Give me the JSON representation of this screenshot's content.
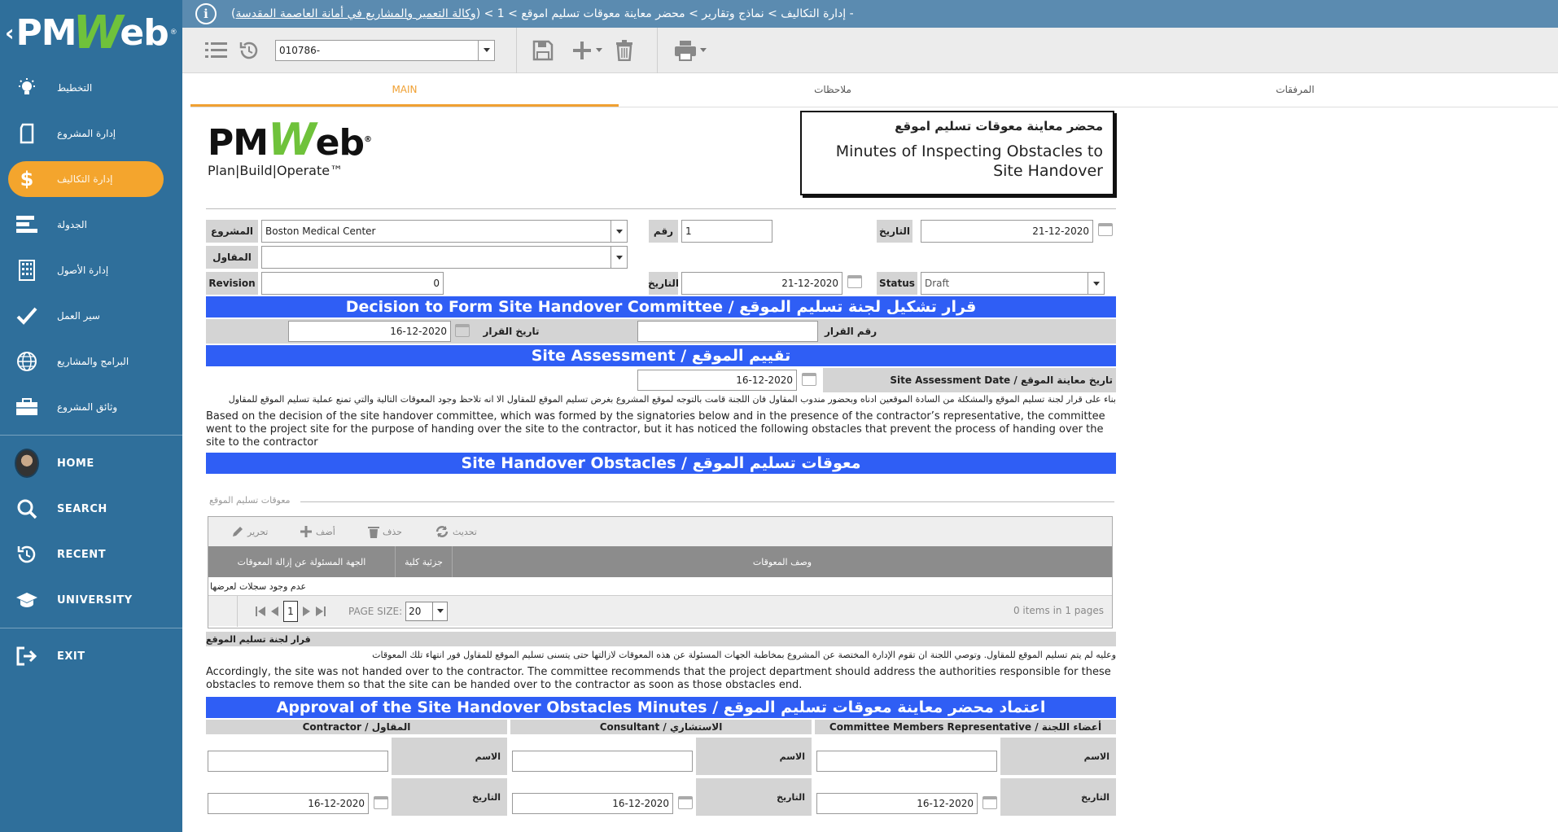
{
  "sidebar": {
    "logo_text": "PMWeb",
    "items": [
      {
        "label": "التخطيط",
        "icon": "lightbulb-icon"
      },
      {
        "label": "إدارة المشروع",
        "icon": "document-icon"
      },
      {
        "label": "إدارة التكاليف",
        "icon": "dollar-icon",
        "active": true
      },
      {
        "label": "الجدولة",
        "icon": "schedule-bars-icon"
      },
      {
        "label": "إدارة الأصول",
        "icon": "building-icon"
      },
      {
        "label": "سير العمل",
        "icon": "checkmark-icon"
      },
      {
        "label": "البرامج والمشاريع",
        "icon": "globe-icon"
      },
      {
        "label": "وثائق المشروع",
        "icon": "briefcase-icon"
      }
    ],
    "lower": [
      {
        "label": "HOME",
        "icon": "avatar"
      },
      {
        "label": "SEARCH",
        "icon": "search-icon"
      },
      {
        "label": "RECENT",
        "icon": "history-icon"
      },
      {
        "label": "UNIVERSITY",
        "icon": "graduation-cap-icon"
      },
      {
        "label": "EXIT",
        "icon": "exit-icon"
      }
    ]
  },
  "topbar": {
    "breadcrumb_prefix": "- إدارة التكاليف > نماذج وتقارير > محضر معاينة معوقات تسليم اموقع > 1 > (",
    "breadcrumb_link": "وكالة التعمير والمشاريع في أمانة العاصمة المقدسة",
    "breadcrumb_suffix": ")"
  },
  "toolbar": {
    "record_select": "010786-"
  },
  "tabs": [
    "MAIN",
    "ملاحظات",
    "المرفقات"
  ],
  "form": {
    "logo_tagline": "Plan|Build|Operate™",
    "title_ar": "محضر معاينة معوقات تسليم اموقع",
    "title_en": "Minutes of Inspecting Obstacles to Site Handover",
    "project_label": "المشروع",
    "project_value": "Boston Medical Center",
    "contractor_label": "المقاول",
    "contractor_value": "",
    "revision_label": "Revision",
    "revision_value": "0",
    "number_label": "رقم",
    "number_value": "1",
    "date_label": "التاريخ",
    "date_value": "21-12-2020",
    "date2_label": "التاريخ",
    "date2_value": "21-12-2020",
    "status_label": "Status",
    "status_value": "Draft",
    "section1": "قرار تشكيل لجنة تسليم الموقع / Decision to Form Site Handover Committee",
    "decision_date_label": "تاريخ القرار",
    "decision_date_value": "16-12-2020",
    "decision_number_label": "رقم  القرار",
    "decision_number_value": "",
    "section2": "تقييم الموقع / Site Assessment",
    "assessment_date_label": "Site Assessment Date / تاريخ معاينة الموقع",
    "assessment_date_value": "16-12-2020",
    "para1_ar": "بناء على قرار لجنة تسليم الموقع والمشكلة من السادة الموقعين ادناه وبحضور مندوب المقاول فان اللجنة قامت بالتوجه لموقع المشروع بغرض تسليم الموقع للمقاول الا انه تلاحظ وجود المعوقات التالية والتي تمنع عملية تسليم الموقع للمقاول",
    "para1_en": "Based on the decision of the site handover committee, which was formed by the signatories below and in the presence of the contractor’s representative, the committee went to the project site for the purpose of handing over the site to the contractor, but it has noticed the following obstacles that prevent the process of handing over the site to the contractor",
    "section3": "معوقات تسليم الموقع / Site Handover Obstacles",
    "grid_caption": "معوقات تسليم الموقع",
    "grid_toolbar": {
      "edit": "تحرير",
      "add": "أضف",
      "delete": "حذف",
      "refresh": "تحديث"
    },
    "grid_columns": [
      "الجهة المسئولة عن إزالة المعوقات",
      "جزئية كلية",
      "وصف المعوقات"
    ],
    "grid_rows": [
      [
        "عدم وجود سجلات لعرضها",
        "",
        ""
      ]
    ],
    "pager": {
      "page": "1",
      "page_size_label": "PAGE SIZE:",
      "page_size": "20",
      "summary": "0 items in 1 pages"
    },
    "decision_committee_label": "قرار لجنة تسليم الموقع",
    "para2_ar": "وعليه لم يتم تسليم الموقع للمقاول. وتوصي اللجنة ان تقوم الإدارة المختصة عن المشروع بمخاطبة الجهات المسئولة عن هذه المعوقات لازالتها حتى يتسنى تسليم الموقع للمقاول فور انتهاء تلك المعوقات",
    "para2_en": "Accordingly, the site was not handed over to the contractor. The committee recommends that the project department should address the authorities responsible for these obstacles to remove them so that the site can be handed over to the contractor as soon as those obstacles end.",
    "section4": "اعتماد محضر معاينة معوقات تسليم الموقع / Approval of the Site Handover Obstacles Minutes",
    "signatories": [
      {
        "header": "Contractor / المقاول",
        "name_label": "الاسم",
        "date_label": "التاريخ",
        "date": "16-12-2020"
      },
      {
        "header": "Consultant / الاستشاري",
        "name_label": "الاسم",
        "date_label": "التاريخ",
        "date": "16-12-2020"
      },
      {
        "header": "Committee Members Representative / أعضاء اللجنة",
        "name_label": "الاسم",
        "date_label": "التاريخ",
        "date": "16-12-2020"
      }
    ]
  },
  "colors": {
    "sidebar": "#2f6f9b",
    "active_pill": "#f4a52d",
    "section_bar": "#2f5ef5",
    "accent_tab": "#f0a032"
  }
}
